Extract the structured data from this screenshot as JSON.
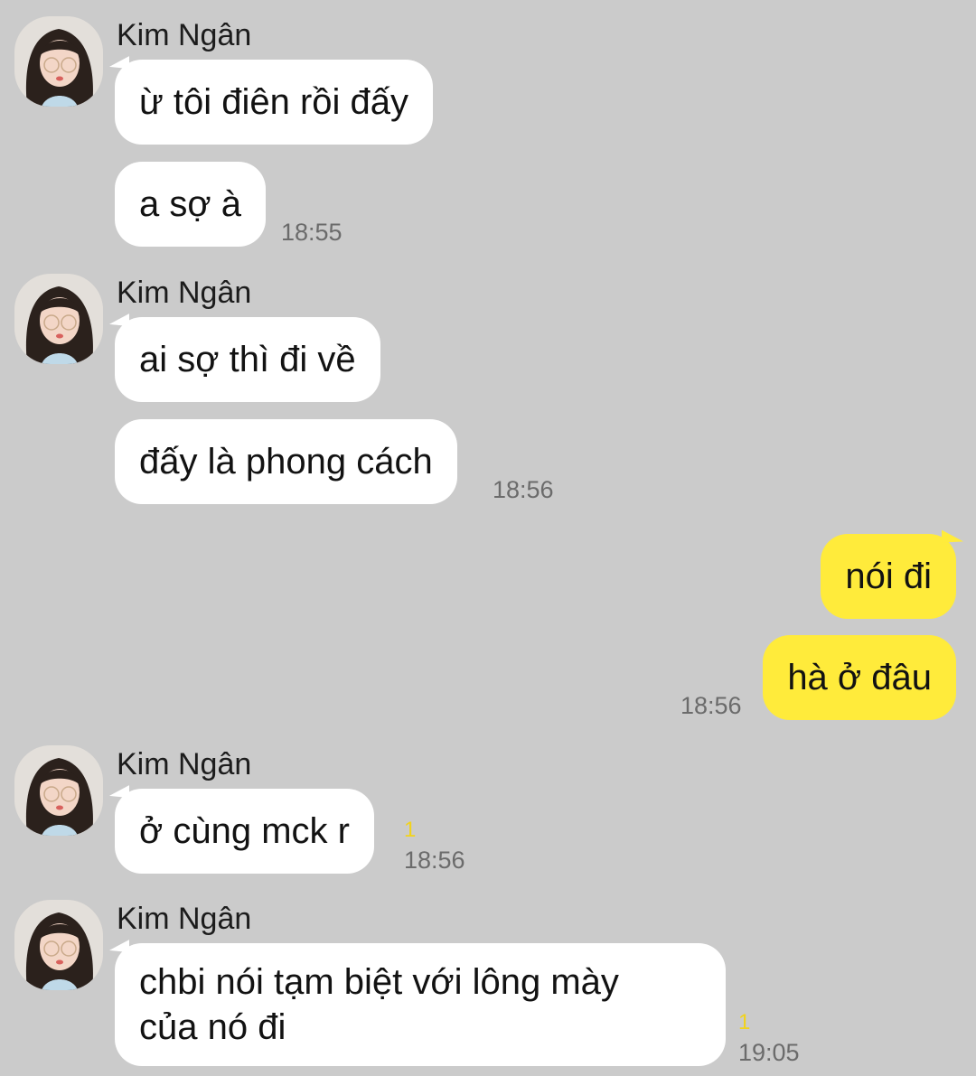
{
  "contact": {
    "name": "Kim Ngân",
    "avatar_icon": "profile-photo-avatar"
  },
  "colors": {
    "background": "#cbcbcb",
    "incoming_bubble": "#ffffff",
    "outgoing_bubble": "#ffeb3b",
    "unread_indicator": "#f2d31b",
    "timestamp": "#6b6b6b"
  },
  "groups": [
    {
      "sender": "Kim Ngân",
      "messages": [
        "ừ tôi điên rồi đấy",
        "a sợ à"
      ],
      "time": "18:55"
    },
    {
      "sender": "Kim Ngân",
      "messages": [
        "ai sợ thì đi về",
        "đấy là phong cách"
      ],
      "time": "18:56"
    },
    {
      "sender": "me",
      "messages": [
        "nói đi",
        "hà ở đâu"
      ],
      "time": "18:56"
    },
    {
      "sender": "Kim Ngân",
      "messages": [
        "ở cùng mck r"
      ],
      "time": "18:56",
      "unread": "1"
    },
    {
      "sender": "Kim Ngân",
      "messages": [
        "chbi nói tạm biệt với lông mày",
        "của nó đi"
      ],
      "time": "19:05",
      "unread": "1"
    }
  ]
}
